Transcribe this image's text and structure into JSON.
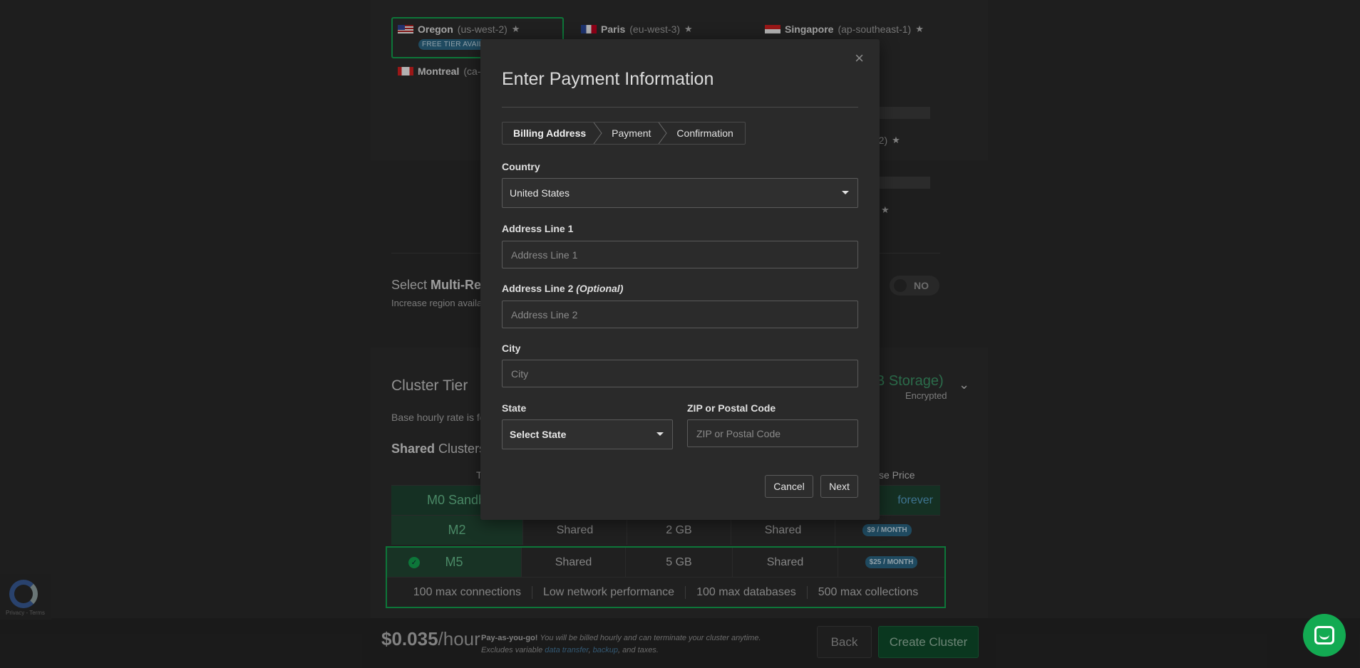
{
  "background": {
    "regions": [
      {
        "name": "Oregon",
        "code": "(us-west-2)",
        "badge": "FREE TIER AVAIL"
      },
      {
        "name": "Paris",
        "code": "(eu-west-3)"
      },
      {
        "name": "Singapore",
        "code": "(ap-southeast-1)"
      },
      {
        "name": "Montreal",
        "code": "(ca-c"
      }
    ],
    "partial_region_code": "-2)",
    "multi_region": {
      "prefix": "Select",
      "bold": "Multi-Reg",
      "sub": "Increase region availa",
      "toggle": "NO"
    },
    "cluster_tier": {
      "title": "Cluster Tier",
      "sub": "Base hourly rate is fo",
      "storage": "B Storage)",
      "encrypted": "Encrypted"
    },
    "shared_clusters": {
      "bold": "Shared",
      "rest": "Clusters"
    },
    "table": {
      "header_t": "T",
      "header_price": "se Price",
      "rows": [
        {
          "name": "M0 Sandb",
          "price": "forever"
        },
        {
          "name": "M2",
          "cpu": "Shared",
          "storage": "2 GB",
          "ram": "Shared",
          "price": "$9 / MONTH"
        },
        {
          "name": "M5",
          "cpu": "Shared",
          "storage": "5 GB",
          "ram": "Shared",
          "price": "$25 / MONTH"
        }
      ],
      "m5_features": [
        "100 max connections",
        "Low network performance",
        "100 max databases",
        "500 max collections"
      ]
    },
    "footer": {
      "price": "$0.035",
      "unit": "/hour",
      "payg_bold": "Pay-as-you-go!",
      "payg_text": "You will be billed hourly and can terminate your cluster anytime. Excludes variable",
      "link1": "data transfer",
      "link2": "backup",
      "payg_end": ", and taxes.",
      "back": "Back",
      "create": "Create Cluster"
    },
    "recaptcha": "Privacy - Terms"
  },
  "modal": {
    "title": "Enter Payment Information",
    "close": "×",
    "steps": [
      "Billing Address",
      "Payment",
      "Confirmation"
    ],
    "country_label": "Country",
    "country_value": "United States",
    "addr1_label": "Address Line 1",
    "addr1_placeholder": "Address Line 1",
    "addr2_label": "Address Line 2",
    "addr2_optional": "(Optional)",
    "addr2_placeholder": "Address Line 2",
    "city_label": "City",
    "city_placeholder": "City",
    "state_label": "State",
    "state_value": "Select State",
    "zip_label": "ZIP or Postal Code",
    "zip_placeholder": "ZIP or Postal Code",
    "cancel": "Cancel",
    "next": "Next"
  },
  "colors": {
    "accent": "#13aa52",
    "badge": "#2d6b8a"
  }
}
